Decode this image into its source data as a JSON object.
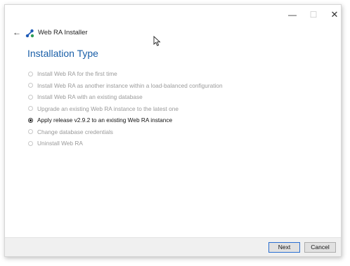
{
  "window": {
    "controls": {
      "minimize": "—",
      "maximize": "☐",
      "close": "✕"
    }
  },
  "header": {
    "back_icon": "←",
    "title": "Web RA Installer",
    "logo_icon": "app-logo-icon"
  },
  "section": {
    "title": "Installation Type"
  },
  "options": [
    {
      "label": "Install Web RA  for the first time",
      "selected": false,
      "enabled": false
    },
    {
      "label": "Install Web RA as another instance within a load-balanced configuration",
      "selected": false,
      "enabled": false
    },
    {
      "label": "Install Web RA with an existing database",
      "selected": false,
      "enabled": false
    },
    {
      "label": "Upgrade an existing Web RA instance to the latest one",
      "selected": false,
      "enabled": false
    },
    {
      "label": "Apply release v2.9.2 to an existing Web RA instance",
      "selected": true,
      "enabled": true
    },
    {
      "label": "Change database credentials",
      "selected": false,
      "enabled": false
    },
    {
      "label": "Uninstall Web RA",
      "selected": false,
      "enabled": false
    }
  ],
  "footer": {
    "next_label": "Next",
    "cancel_label": "Cancel"
  },
  "colors": {
    "accent_title": "#1a5fa8",
    "logo_blue": "#1e5bb8",
    "logo_green": "#2e9c56"
  }
}
